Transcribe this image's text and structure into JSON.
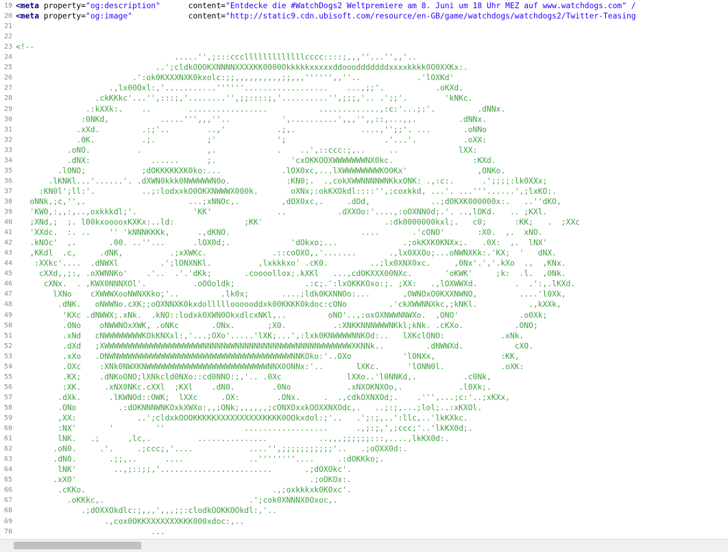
{
  "editor": {
    "lines": [
      {
        "n": "19",
        "meta": true,
        "prop": "og:description",
        "content": "Entdecke die #WatchDogs2 Weltpremiere am 8. Juni um 18 Uhr MEZ auf www.watchdogs.com\" /"
      },
      {
        "n": "20",
        "meta": true,
        "prop": "og:image",
        "content": "http://static9.cdn.ubisoft.com/resource/en-GB/game/watchdogs/watchdogs2/Twitter-Teasing"
      },
      {
        "n": "21",
        "text": ""
      },
      {
        "n": "22",
        "text": ""
      },
      {
        "n": "23",
        "text": "<!--"
      },
      {
        "n": "24",
        "text": "                                  .....'',;:::ccclllllllllllllcccc::::;,,,''...'',,'.."
      },
      {
        "n": "25",
        "text": "                              ..';cldkOOOKXNNNNXXXXKK0000Okkkkkxxxxxddooodddddddxxxxkkkk0O0XXKx:."
      },
      {
        "n": "26",
        "text": "                         .':ok0KXXXNXK0kxolc:;;,,,,,,,,,,;;,,,'''''',,''..            .'lOXKd'"
      },
      {
        "n": "27",
        "text": "                    .,lx00Oxl:,'...........''''''..................    ...,;;'.           .oKXd."
      },
      {
        "n": "28",
        "text": "                 .ckKKkc'...'',:::;,'........'',;;::::;,'..........'',;;;,'.. .';;'.        'kNKc."
      },
      {
        "n": "29",
        "text": "               .:kXXk:.    ..        .................           .............,:c:'...;:'.         .dNNx."
      },
      {
        "n": "30",
        "text": "              :0NKd,           .....''',,,''..           ',..........',,,'',,::,...,,.         .dNNx."
      },
      {
        "n": "31",
        "text": "             .xXd.         .:;'..        ..,'           .;,.              ....,'';;'. ...       .oNNo"
      },
      {
        "n": "32",
        "text": "             .0K.          .;.           ;'             ';                     .'...'.          .oXX:"
      },
      {
        "n": "33",
        "text": "           .oNO.          .              ,.             .    ..',::ccc:;,..     ..             lXX:"
      },
      {
        "n": "34",
        "text": "           .dNX:             ......      ;.                'cxOKKOOXWWWWWWWNX0kc.                 :KXd."
      },
      {
        "n": "35",
        "text": "         .lONO;            ;dOKKKKKXK0ko:...             .lOX0xc,...lXWWWWWWWWKO0Kx'               ,ONKo."
      },
      {
        "n": "36",
        "text": "       .lKNKl...'......'. .dXWN0kkk0NWWWWWN0o.            :KN0;.  .,cokXWWNNNNWNKkxONK: .,:c:.      .';;;;:lk0XXx;"
      },
      {
        "n": "37",
        "text": "     :KN0l';ll:'.          ..;:lodxxkO0OKXNWWWX000k.       oXNx;:okKXOkdl::::'',;coxkkd, ...'. ...'''......',;lxKO:."
      },
      {
        "n": "38",
        "text": "   oNNk,;c,'',.                      ...;xNNOc,.         ,dOX0xc,.     .dOd,             ..;dOKXK000000x:.   ..''dKO,"
      },
      {
        "n": "39",
        "text": "   'KW0,:,,:,..,oxkkkdl;'.            'KK'              ..           .dXXOo:'....,:oOXNN0d;.'. ..,lOKd.   .. ;KXl."
      },
      {
        "n": "40",
        "text": "   ;XNd,;  ;. l00kxooooxKXKx:..ld:               ;KK'                          .:dk0000000kxl;.   c0;      :KK;   .  ;XXc"
      },
      {
        "n": "41",
        "text": "   'XXdc.  :. ..    '' 'kNNNKKKk,      .,dKNO.                            ....       .'cONO'       :X0.  ,.  xNO."
      },
      {
        "n": "42",
        "text": "   .kNOc'  ,.       .00. ..''...      .lOX0d;.             'dOkxo;...              .;okKXK0KNXx;.   .0X:  ,.  lNX'"
      },
      {
        "n": "43",
        "text": "   ,KKdl  .c,     .dNK,          .;xXWKc.              .::coOXO,,'.......       .,lx0XXOo;...oNWNXKk:.'KX;  '   dNX."
      },
      {
        "n": "44",
        "text": "    :XXkc'....  .dNWXl         .';lONXNKl.          ,lxkkkxo' .cK0.         ..;lx0XNX0xc.     ,0Nx'.','.kXo  .,  ,KNx."
      },
      {
        "n": "45",
        "text": "     cXXd,,;:, .oXWNNKo'    .'..  .'.'dKk;       .coooollox;.kXKl   ...,cdOKXXX00NXc.       'oKWK'     ;k:  .l.  ,0Nk."
      },
      {
        "n": "46",
        "text": "      cXNx.  . ,KWX0NNNXOl'.          .oOOoldk;               .:c;.':lxOKKKOxo:;. ;XX:   .,lOXWWXd.        .  .':,.lKXd."
      },
      {
        "n": "47",
        "text": "        lXNo    cXWWWXooNWNXKko;'..         .lk0x;       ....;ldk0KXNNOo:...       ,OWNOxO0KXXNWNO,         ....'l0Xk,"
      },
      {
        "n": "48",
        "text": "         .dNK.   oNWWNo.cXK;;oOXNNXK0kxdollllloooooddxk00KKKK0kdoc:cONo         .'ckXWWNNXkc,;kNKl.           .,kXXk,"
      },
      {
        "n": "49",
        "text": "          'KXc .dNWWX;.xNk.  .kNO::lodxk0XWN0OkxdlcxNKl,..         oNO'..,:oxOXNWWNNWXo.  ,ONO'             .o0Xk;"
      },
      {
        "n": "50",
        "text": "          .ONo    oNWWNOxXWK, .oNKc       .ONx.       ;X0.          .:XNKKNNNWWWNKkl;kNk. .cKXo.           .ONO;"
      },
      {
        "n": "51",
        "text": "          .xNd   cNWWWWWWWWKOkKNXxl:,'...;OXo'.....'lXK;...',:lxk0KNWWWWNNKOd:..   lXKclONO:            .xNk."
      },
      {
        "n": "52",
        "text": "          .dXd   ;XWWWWWWWWWWWWWWWWWWWWWNNNNNWWNNNNNNNNNNWWWNNNNNWWWWWWWXKNNk..         .dNWWXd.           cXO."
      },
      {
        "n": "53",
        "text": "          .xXo   .ONWNWWWWWWWWWWWWWWWWWWWWWWWWWWWWWWWWWWWWWNNKOko:'..OXo           'l0NXx,              :KK,"
      },
      {
        "n": "54",
        "text": "          .OXc    :XNk0NWXKNWWWWWWWWWWWWWWWWWWWWWWWWWWNNX0ONNx:'..       lXKc.      'lONN0l.            .oXK:"
      },
      {
        "n": "55",
        "text": "          .KX;    .dNKoONO;lXNkcld0NXo::cd0NNO:;,'.. .0Xc              lXXo..'l0NNKd,.          .c0Nk,"
      },
      {
        "n": "56",
        "text": "          :XK.     .xNX0NKc.cXXl  ;KXl    .dN0.        .0No            .xNXOKNXOo,.            .l0Xk;."
      },
      {
        "n": "57",
        "text": "         .dXk.      .lKWNOd::OWK;  lXXc     .OX:        .ONx.     .  .,cdkOXNXOd;.    .''',...;c:'..;xKXx,"
      },
      {
        "n": "58",
        "text": "         .ONo         .:dOKNNNWNKOxkXWXo:,,;ONk;,,,,,,;cONXOxxkOOXXNXOdc,.   ..;:;,...;lol;..:xKXOl."
      },
      {
        "n": "59",
        "text": "         ,XX:             ..';cldxkOOOKKKKKXXXXXXXXXXKKKK0OOkxdol:;'..   .';:;,..':llc,..'lkKXkc."
      },
      {
        "n": "60",
        "text": "         :NX'       '         ''                 ..................      .,;:;,',;ccc;'..'lkKX0d;."
      },
      {
        "n": "61",
        "text": "         lNK.   .;      ,lc,.          ...............           ..,,,;;;;;;:::,....,lkKX0d:."
      },
      {
        "n": "62",
        "text": "        .oN0.     .'.     .;ccc;,'....            ....'',;;;;;;;;;;;'..   .;oOXX0d:."
      },
      {
        "n": "63",
        "text": "        .dN0.       .;;,..      ....              ..''''''''....     .:dOKKko;."
      },
      {
        "n": "64",
        "text": "         lNK'        ..,;::;;,'........................       .;dOXOkc'."
      },
      {
        "n": "65",
        "text": "        .xXO'                                                  .;oOKOx:."
      },
      {
        "n": "66",
        "text": "         .cKKo.                                        .,;oxkkkxk0K0xc'."
      },
      {
        "n": "67",
        "text": "           .oKKkc,.                               .';cok0XNNNX0Oxoc,."
      },
      {
        "n": "68",
        "text": "              .;dOXXOkdlc:;,,,',,,;;:clodkOOKKOOkdl:,'.."
      },
      {
        "n": "69",
        "text": "                   .,cox0OKKXXXXXXXKKK000xdoc:,.."
      },
      {
        "n": "70",
        "text": "                             ..."
      }
    ]
  }
}
